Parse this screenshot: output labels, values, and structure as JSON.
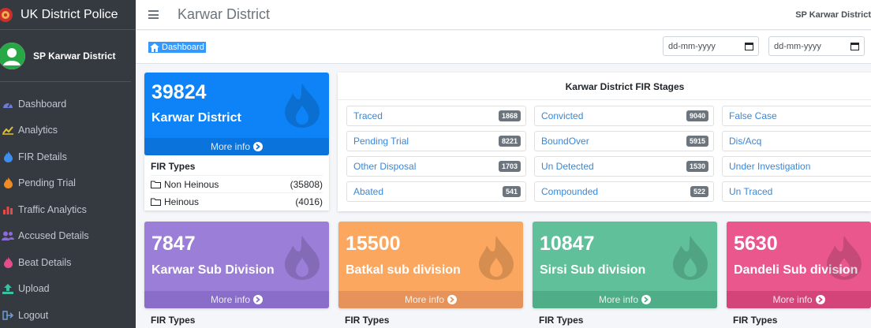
{
  "app": {
    "brand": "UK District Police"
  },
  "user": {
    "name": "SP Karwar District"
  },
  "sidebar": {
    "items": [
      {
        "label": "Dashboard",
        "icon": "tachometer-icon",
        "color": "#6c7bd6"
      },
      {
        "label": "Analytics",
        "icon": "line-chart-icon",
        "color": "#e6c229"
      },
      {
        "label": "FIR Details",
        "icon": "fire-icon",
        "color": "#3b8ff0"
      },
      {
        "label": "Pending Trial",
        "icon": "fire-icon",
        "color": "#f08a24"
      },
      {
        "label": "Traffic Analytics",
        "icon": "bar-chart-icon",
        "color": "#e84a4a"
      },
      {
        "label": "Accused Details",
        "icon": "users-icon",
        "color": "#8c6ad8"
      },
      {
        "label": "Beat Details",
        "icon": "fire-icon",
        "color": "#e74c8a"
      },
      {
        "label": "Upload",
        "icon": "upload-icon",
        "color": "#3bbfa0"
      },
      {
        "label": "Logout",
        "icon": "logout-icon",
        "color": "#6c9bd0"
      }
    ]
  },
  "header": {
    "title": "Karwar District",
    "user": "SP Karwar District"
  },
  "breadcrumb": {
    "label": "Dashboard"
  },
  "filters": {
    "from_placeholder": "dd-mm-yyyy",
    "to_placeholder": "dd-mm-yyyy"
  },
  "district_box": {
    "count": "39824",
    "label": "Karwar District",
    "more": "More info",
    "color": "#0d83f7"
  },
  "fir_types": {
    "title": "FIR Types",
    "rows": [
      {
        "label": "Non Heinous",
        "count": "(35808)"
      },
      {
        "label": "Heinous",
        "count": "(4016)"
      }
    ]
  },
  "stages": {
    "title": "Karwar District FIR Stages",
    "items": [
      {
        "label": "Traced",
        "count": "1868"
      },
      {
        "label": "Convicted",
        "count": "9040"
      },
      {
        "label": "False Case",
        "count": ""
      },
      {
        "label": "Pending Trial",
        "count": "8221"
      },
      {
        "label": "BoundOver",
        "count": "5915"
      },
      {
        "label": "Dis/Acq",
        "count": ""
      },
      {
        "label": "Other Disposal",
        "count": "1703"
      },
      {
        "label": "Un Detected",
        "count": "1530"
      },
      {
        "label": "Under Investigation",
        "count": ""
      },
      {
        "label": "Abated",
        "count": "541"
      },
      {
        "label": "Compounded",
        "count": "522"
      },
      {
        "label": "Un Traced",
        "count": ""
      }
    ]
  },
  "subdivisions": [
    {
      "count": "7847",
      "label": "Karwar Sub Division",
      "more": "More info",
      "fir_title": "FIR Types",
      "color": "#9b7ed7",
      "footer": "#8a6cc9"
    },
    {
      "count": "15500",
      "label": "Batkal sub division",
      "more": "More info",
      "fir_title": "FIR Types",
      "color": "#fca75f",
      "footer": "#e5935a"
    },
    {
      "count": "10847",
      "label": "Sirsi Sub division",
      "more": "More info",
      "fir_title": "FIR Types",
      "color": "#5fc09a",
      "footer": "#4fad88"
    },
    {
      "count": "5630",
      "label": "Dandeli Sub division",
      "more": "More info",
      "fir_title": "FIR Types",
      "color": "#e9578d",
      "footer": "#d34579"
    }
  ]
}
